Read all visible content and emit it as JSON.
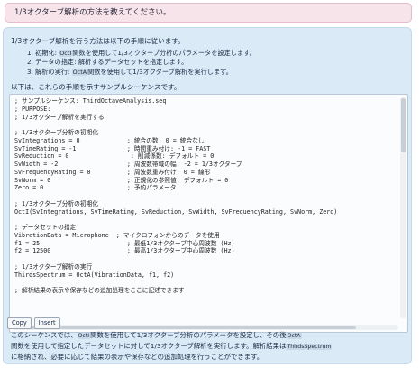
{
  "user_message": "1/3オクターブ解析の方法を教えてください。",
  "answer": {
    "intro": "1/3オクターブ解析を行う方法は以下の手順に従います。",
    "steps": [
      {
        "num": "1.",
        "pre": "初期化: ",
        "token": "OctI",
        "post": "関数を使用して1/3オクターブ分析のパラメータを設定します。"
      },
      {
        "num": "2.",
        "pre": "データの指定: 解析するデータセットを指定します。",
        "token": "",
        "post": ""
      },
      {
        "num": "3.",
        "pre": "解析の実行: ",
        "token": "OctA",
        "post": "関数を使用して1/3オクターブ解析を実行します。"
      }
    ],
    "sample_intro": "以下は、これらの手順を示すサンプルシーケンスです。",
    "code_lines": [
      "; サンプルシーケンス: ThirdOctaveAnalysis.seq",
      "; PURPOSE:",
      "; 1/3オクターブ解析を実行する",
      "",
      "; 1/3オクターブ分析の初期化",
      "SvIntegrations = 0             ; 統合の数: 0 = 統合なし",
      "SvTimeRating = -1              ; 時間重み付け: -1 = FAST",
      "SvReduction = 0                 ; 削減係数: デフォルト = 0",
      "SvWidth = -2                   ; 周波数帯域の幅: -2 = 1/3オクターブ",
      "SvFrequencyRating = 0          ; 周波数重み付け: 0 = 線形",
      "SvNorm = 0                     ; 正規化の参照値: デフォルト = 0",
      "Zero = 0                       ; 予約パラメータ",
      "",
      "; 1/3オクターブ分析の初期化",
      "OctI(SvIntegrations, SvTimeRating, SvReduction, SvWidth, SvFrequencyRating, SvNorm, Zero)",
      "",
      "; データセットの指定",
      "VibrationData = Microphone  ; マイクロフォンからのデータを使用",
      "f1 = 25                        ; 最低1/3オクターブ中心周波数 (Hz)",
      "f2 = 12500                     ; 最高1/3オクターブ中心周波数 (Hz)",
      "",
      "; 1/3オクターブ解析の実行",
      "ThirdsSpectrum = OctA(VibrationData, f1, f2)",
      "",
      "; 解析結果の表示や保存などの追加処理をここに記述できます"
    ],
    "buttons": {
      "copy": "Copy",
      "insert": "Insert"
    },
    "summary": {
      "l1_a": "このシーケンスでは、",
      "l1_tok": "OctI",
      "l1_b": "関数を使用して1/3オクターブ分析のパラメータを設定し、その後",
      "l1_tok2": "OctA",
      "l2_a": "関数を使用して指定したデータセットに対して1/3オクターブ解析を実行します。解析結果は",
      "l2_tok": "ThirdsSpectrum",
      "l3": "に格納され、必要に応じて結果の表示や保存などの追加処理を行うことができます。"
    }
  }
}
